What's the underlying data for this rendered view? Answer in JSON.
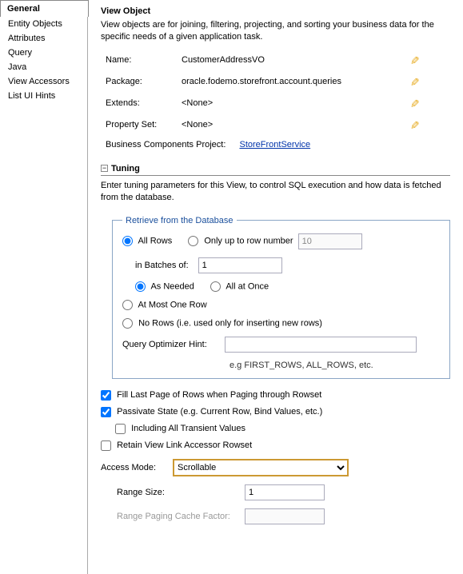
{
  "sidebar": {
    "selected": "General",
    "items": [
      "Entity Objects",
      "Attributes",
      "Query",
      "Java",
      "View Accessors",
      "List UI Hints"
    ]
  },
  "main": {
    "title": "View Object",
    "description": "View objects are for joining, filtering, projecting, and sorting your business data for the specific needs of a given application task.",
    "props": {
      "name_label": "Name:",
      "name_value": "CustomerAddressVO",
      "package_label": "Package:",
      "package_value": "oracle.fodemo.storefront.account.queries",
      "extends_label": "Extends:",
      "extends_value": "<None>",
      "propertyset_label": "Property Set:",
      "propertyset_value": "<None>"
    },
    "bc_project_label": "Business Components Project:",
    "bc_project_link": "StoreFrontService"
  },
  "tuning": {
    "title": "Tuning",
    "description": "Enter tuning parameters for this View, to control SQL execution and how data is fetched from the database.",
    "fieldset_legend": "Retrieve from the Database",
    "all_rows_label": "All Rows",
    "only_up_to_label": "Only up to row number",
    "only_up_to_value": "10",
    "in_batches_label": "in Batches of:",
    "in_batches_value": "1",
    "as_needed_label": "As Needed",
    "all_at_once_label": "All at Once",
    "at_most_one_label": "At Most One Row",
    "no_rows_label": "No Rows (i.e. used only for inserting new rows)",
    "optimizer_hint_label": "Query Optimizer Hint:",
    "optimizer_hint_value": "",
    "optimizer_hint_sub": "e.g FIRST_ROWS, ALL_ROWS, etc.",
    "fill_last_page_label": "Fill Last Page of Rows when Paging through Rowset",
    "passivate_label": "Passivate State (e.g. Current Row, Bind Values, etc.)",
    "including_transient_label": "Including All Transient Values",
    "retain_view_link_label": "Retain View Link Accessor Rowset",
    "access_mode_label": "Access Mode:",
    "access_mode_value": "Scrollable",
    "range_size_label": "Range Size:",
    "range_size_value": "1",
    "range_paging_label": "Range Paging Cache Factor:",
    "range_paging_value": ""
  }
}
